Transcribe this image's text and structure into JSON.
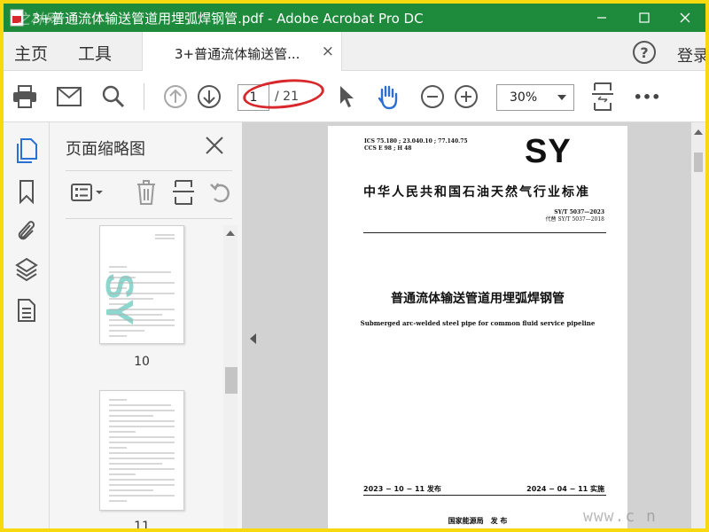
{
  "window": {
    "title": "3+普通流体输送管道用埋弧焊钢管.pdf - Adobe Acrobat Pro DC",
    "minimize_icon": "minimize-icon",
    "maximize_icon": "maximize-icon",
    "close_icon": "close-icon"
  },
  "watermark": {
    "left_text": "之林网",
    "right_text": "www.c    n"
  },
  "menubar": {
    "home": "主页",
    "tools": "工具",
    "doc_tab_label": "3+普通流体输送管...",
    "doc_tab_close": "×",
    "help": "?",
    "login": "登录"
  },
  "toolbar": {
    "current_page": "1",
    "page_total": "/ 21",
    "zoom": "30%",
    "more": "•••"
  },
  "thumb_panel": {
    "title": "页面缩略图",
    "thumbnails": [
      {
        "page": "10"
      },
      {
        "page": "11"
      }
    ]
  },
  "document_page": {
    "ics_line": "ICS 75.180 ; 23.040.10 ; 77.140.75",
    "ccs_line": "CCS E 98 ; H 48",
    "sy_mark": "SY",
    "standard_name": "中华人民共和国石油天然气行业标准",
    "code": "SY/T 5037—2023",
    "replaces": "代替 SY/T 5037—2018",
    "title_cn": "普通流体输送管道用埋弧焊钢管",
    "title_en": "Submerged arc-welded steel pipe for common fluid service pipeline",
    "issue_date": "2023 − 10 − 11 发布",
    "effective_date": "2024 − 04 − 11 实施",
    "publisher": "国家能源局　发 布"
  },
  "colors": {
    "frame": "#f8d90f",
    "titlebar": "#1e8a3c",
    "accent_blue": "#2a6fd4",
    "highlight_red": "#d8282b",
    "thumb_sy_green": "#2fb7a8"
  }
}
